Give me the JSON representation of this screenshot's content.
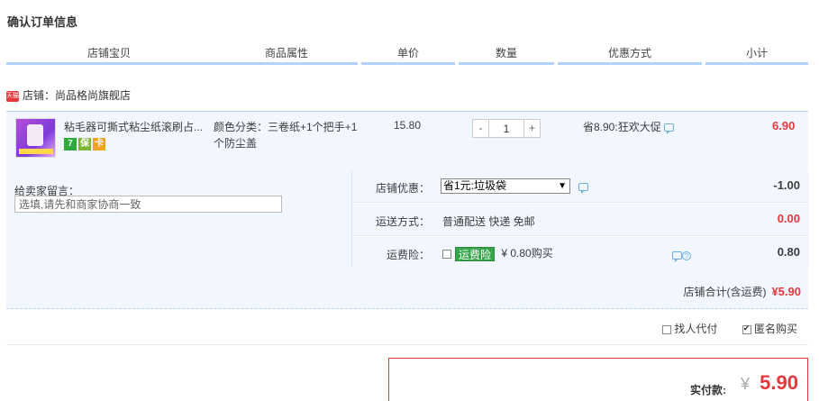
{
  "page_title": "确认订单信息",
  "header": {
    "columns": [
      "店铺宝贝",
      "商品属性",
      "单价",
      "数量",
      "优惠方式",
      "小计"
    ]
  },
  "shop": {
    "badge": "天猫",
    "label": "店铺：尚品格尚旗舰店"
  },
  "item": {
    "title": "粘毛器可撕式粘尘纸滚刷占...",
    "attr": "颜色分类：三卷纸+1个把手+1个防尘盖",
    "price": "15.80",
    "qty_minus": "-",
    "qty_value": "1",
    "qty_plus": "+",
    "promo": "省8.90:狂欢大促",
    "subtotal": "6.90",
    "icons": [
      "7-day-return-icon",
      "guarantee-icon",
      "card-icon"
    ],
    "icon_texts": [
      "7",
      "保",
      "卡"
    ]
  },
  "message": {
    "label": "给卖家留言：",
    "placeholder": "选填,请先和商家协商一致"
  },
  "options": {
    "shop_discount_label": "店铺优惠：",
    "shop_discount_value": "省1元:垃圾袋",
    "shop_discount_arrow": "▼",
    "shop_discount_amount": "-1.00",
    "delivery_label": "运送方式：",
    "delivery_value": "普通配送 快递 免邮",
    "delivery_amount": "0.00",
    "insurance_label": "运费险：",
    "insurance_tag": "运费险",
    "insurance_text": "¥ 0.80购买",
    "insurance_amount": "0.80"
  },
  "shop_total": {
    "label": "店铺合计(含运费)",
    "amount": "¥5.90"
  },
  "bottom": {
    "proxy_pay": "找人代付",
    "anonymous": "匿名购买",
    "anonymous_checked": true
  },
  "pay": {
    "label": "实付款:",
    "currency": "¥",
    "amount": "5.90"
  },
  "colors": {
    "accent_red": "#e4393c",
    "header_bar": "#b2d1ff",
    "row_bg": "#f2f7ff",
    "insurance_green": "#36a54b"
  }
}
